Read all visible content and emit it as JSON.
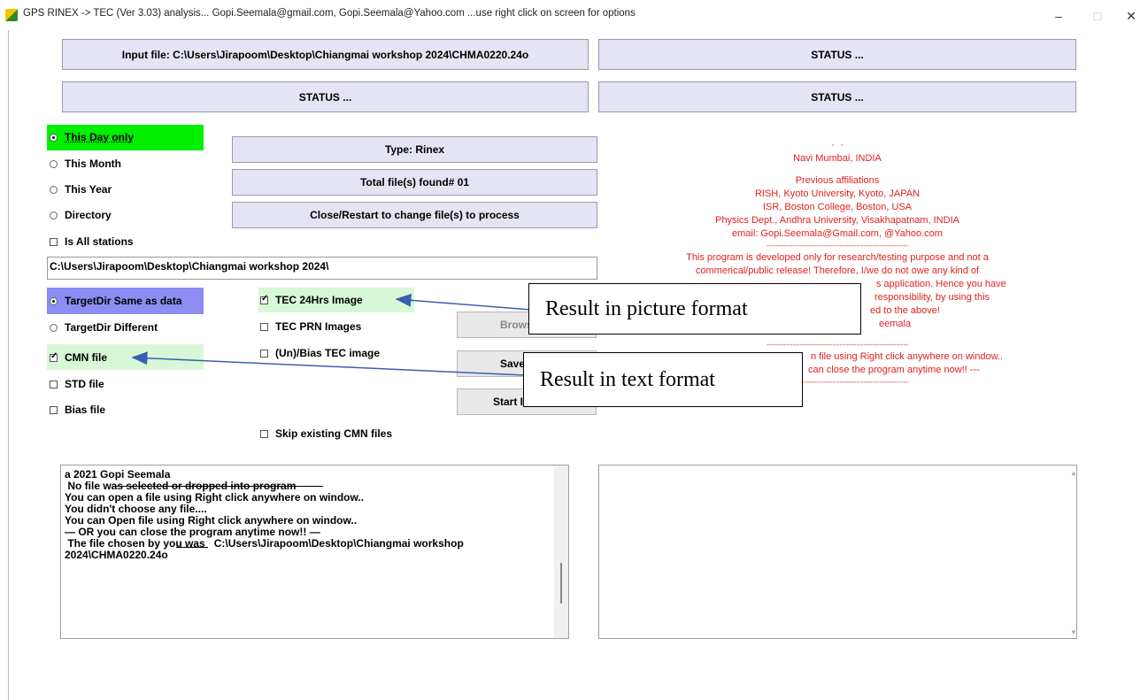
{
  "window": {
    "title": "GPS RINEX -> TEC (Ver 3.03) analysis... Gopi.Seemala@gmail.com, Gopi.Seemala@Yahoo.com  ...use right click on screen for options",
    "minimize": "–",
    "maximize": "□",
    "close": "✕"
  },
  "top_panels": {
    "input_file": "Input file: C:\\Users\\Jirapoom\\Desktop\\Chiangmai workshop 2024\\CHMA0220.24o",
    "status_top_right": "STATUS ...",
    "status_mid_left": "STATUS ...",
    "status_mid_right": "STATUS ..."
  },
  "range_options": {
    "this_day": "This Day only",
    "this_month": "This Month",
    "this_year": "This Year",
    "directory": "Directory",
    "is_all_stations": "Is All stations"
  },
  "info_buttons": {
    "type": "Type: Rinex",
    "total_files": "Total file(s) found# 01",
    "close_restart": "Close/Restart to change file(s) to process"
  },
  "directory_path": "C:\\Users\\Jirapoom\\Desktop\\Chiangmai workshop 2024\\",
  "target_options": {
    "same_as_data": "TargetDir Same as data",
    "different": "TargetDir Different"
  },
  "output_options": {
    "cmn_file": "CMN file",
    "std_file": "STD file",
    "bias_file": "Bias file",
    "tec_24hrs_image": "TEC 24Hrs Image",
    "tec_prn_images": "TEC PRN Images",
    "unbias_tec_image": "(Un)/Bias TEC image",
    "skip_existing": "Skip existing CMN files"
  },
  "action_buttons": {
    "browse": "Brows",
    "save": "Save",
    "start": "Start I"
  },
  "info_text": [
    "Navi Mumbai, INDIA",
    "",
    "Previous affiliations",
    "RISH, Kyoto University, Kyoto, JAPAN",
    "ISR, Boston College, Boston, USA",
    "Physics Dept., Andhra University, Visakhapatnam, INDIA",
    "email: Gopi.Seemala@Gmail.com, @Yahoo.com",
    "------------------------------------------------------------",
    "This program is developed only for research/testing purpose and not a",
    "commerical/public release! Therefore, I/we do not owe any kind of",
    "s application. Hence you have",
    "responsibility, by using this",
    "ed to the above!",
    "eemala",
    "",
    "------------------------------------------------------------",
    "n file using Right click anywhere on window..",
    "can close the program anytime now!! ---",
    "------------------------------------------------------------"
  ],
  "callouts": {
    "picture": "Result in picture format",
    "text": "Result in text format"
  },
  "log_lines": [
    "a 2021 Gopi Seemala",
    "",
    "",
    " No file was selected or dropped into program",
    "You can open a file using Right click anywhere on window..",
    "",
    "",
    "You didn't choose any file....",
    "You can Open file using Right click anywhere on window..",
    "— OR you can close the program anytime now!! —",
    " The file chosen by you was   C:\\Users\\Jirapoom\\Desktop\\Chiangmai workshop",
    "2024\\CHMA0220.24o"
  ],
  "colors": {
    "panel": "#e4e4f4",
    "selected_green": "#00f000",
    "light_green": "#d7f7d7",
    "target_purple": "#8c8cf2",
    "info_red": "#e02020",
    "arrow_blue": "#3a5fb0"
  }
}
